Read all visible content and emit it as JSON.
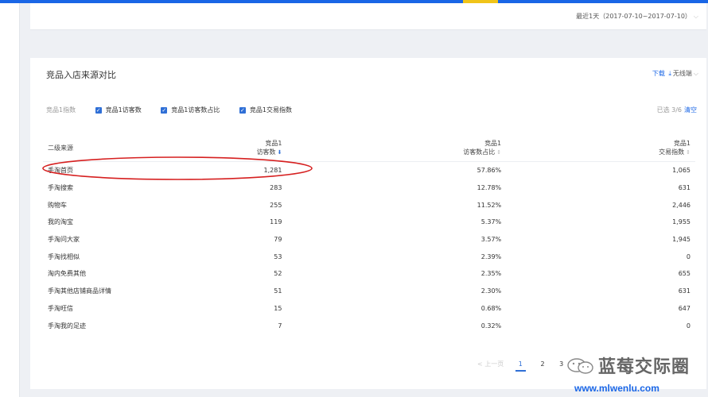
{
  "date_filter": {
    "label": "最近1天",
    "range": "（2017-07-10~2017-07-10）"
  },
  "card": {
    "title": "竞品入店来源对比",
    "download_label": "下载",
    "wireless_label": "无线端"
  },
  "filters": {
    "label": "竞品1指数",
    "items": [
      "竞品1访客数",
      "竞品1访客数占比",
      "竞品1交易指数"
    ],
    "selected_text": "已选 3/6",
    "clear_label": "清空"
  },
  "table": {
    "headers": [
      {
        "line1": "",
        "line2": "二级来源"
      },
      {
        "line1": "竞品1",
        "line2": "访客数"
      },
      {
        "line1": "竞品1",
        "line2": "访客数占比"
      },
      {
        "line1": "竞品1",
        "line2": "交易指数"
      }
    ],
    "rows": [
      [
        "手淘首页",
        "1,281",
        "57.86%",
        "1,065"
      ],
      [
        "手淘搜索",
        "283",
        "12.78%",
        "631"
      ],
      [
        "购物车",
        "255",
        "11.52%",
        "2,446"
      ],
      [
        "我的淘宝",
        "119",
        "5.37%",
        "1,955"
      ],
      [
        "手淘问大家",
        "79",
        "3.57%",
        "1,945"
      ],
      [
        "手淘找相似",
        "53",
        "2.39%",
        "0"
      ],
      [
        "淘内免费其他",
        "52",
        "2.35%",
        "655"
      ],
      [
        "手淘其他店铺商品详情",
        "51",
        "2.30%",
        "631"
      ],
      [
        "手淘旺信",
        "15",
        "0.68%",
        "647"
      ],
      [
        "手淘我的足迹",
        "7",
        "0.32%",
        "0"
      ]
    ]
  },
  "pagination": {
    "prev": "< 上一页",
    "pages": [
      "1",
      "2",
      "3"
    ],
    "next": "下"
  },
  "watermark": {
    "title": "蓝莓交际圈",
    "url": "www.mlwenlu.com"
  },
  "colors": {
    "accent": "#1a66e6",
    "checkbox": "#2f6fd6",
    "highlight": "#d62020",
    "topbar_active": "#f0c419"
  }
}
